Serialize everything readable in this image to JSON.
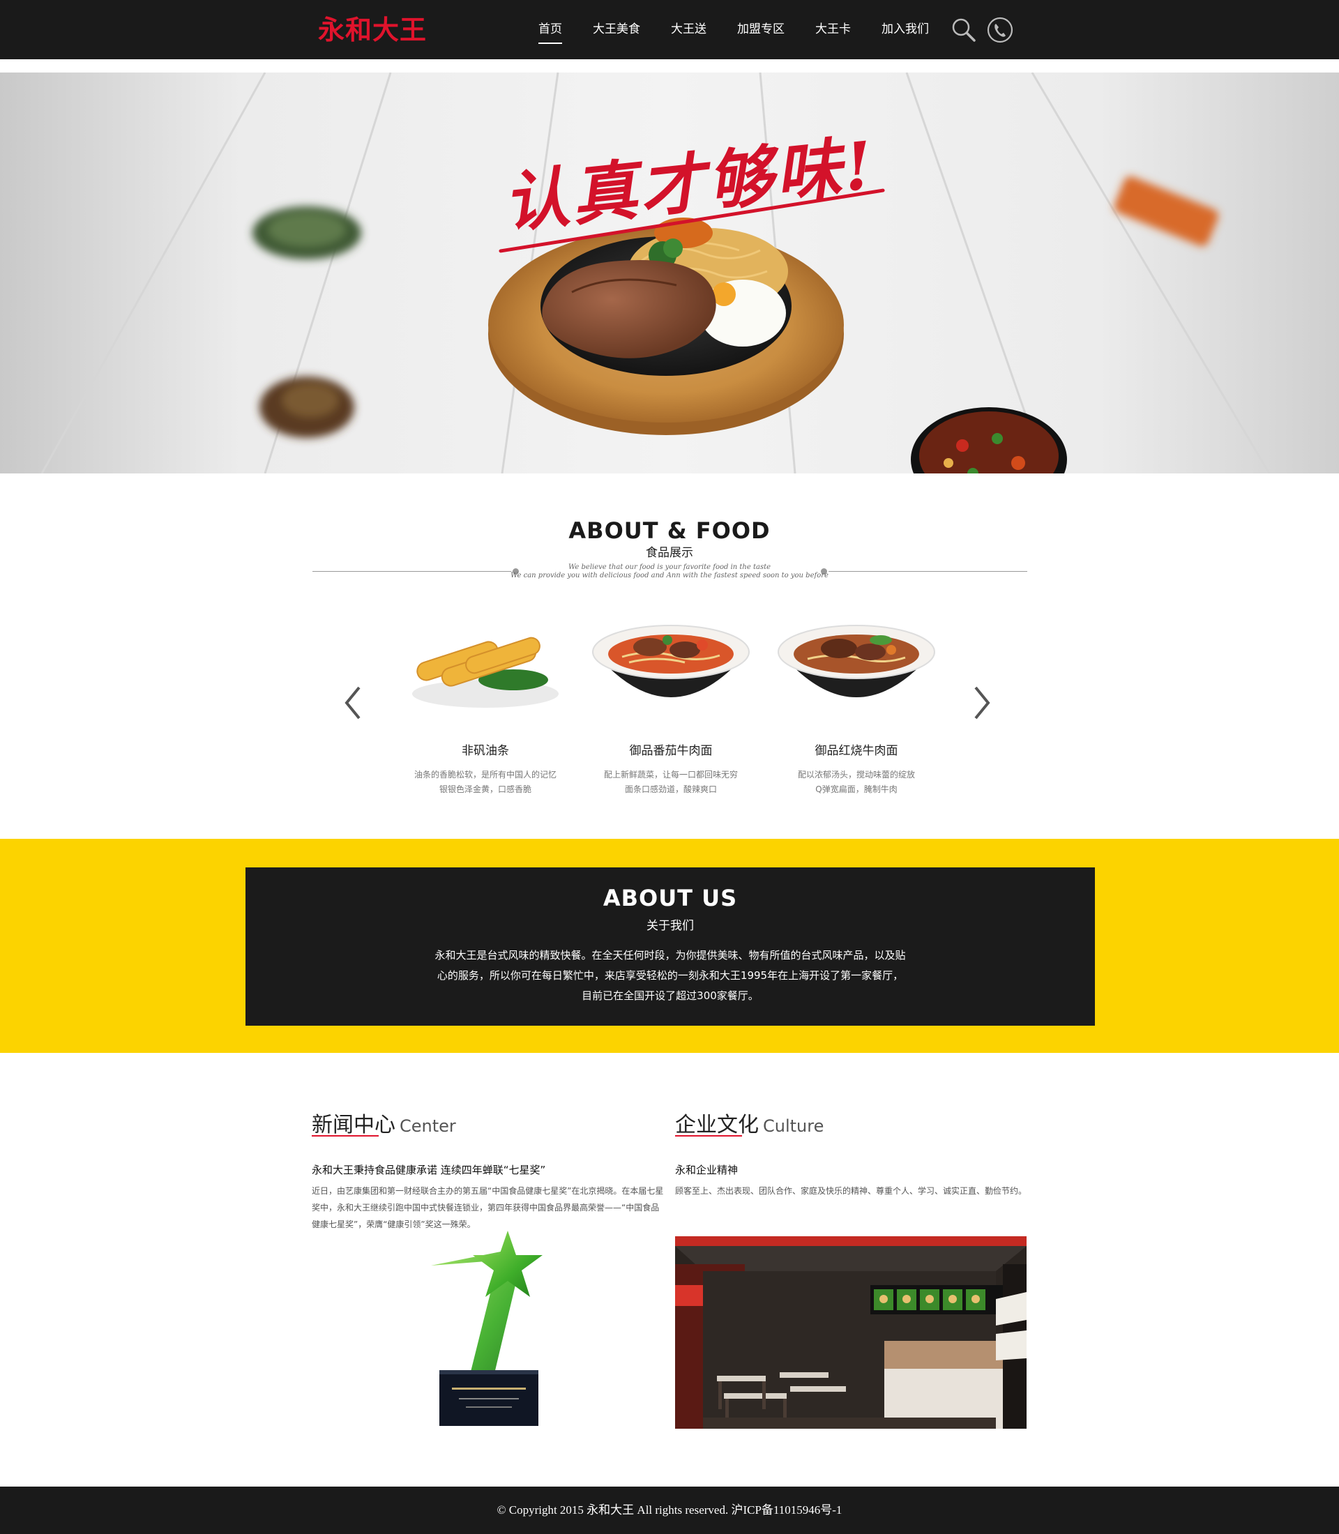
{
  "header": {
    "logo": "永和大王",
    "nav": [
      "首页",
      "大王美食",
      "大王送",
      "加盟专区",
      "大王卡",
      "加入我们"
    ],
    "active_nav": "首页",
    "icons": [
      "search-icon",
      "phone-icon"
    ]
  },
  "hero": {
    "slogan": "认真才够味!"
  },
  "about_food": {
    "title": "ABOUT & FOOD",
    "subtitle": "食品展示",
    "script_line1": "We believe that our food is your favorite food in the taste",
    "script_line2": "We can provide you with delicious food and Ann with the fastest speed soon to you before",
    "items": [
      {
        "name": "非矾油条",
        "desc1": "油条的香脆松软，是所有中国人的记忆",
        "desc2": "银银色泽金黄，口感香脆"
      },
      {
        "name": "御品番茄牛肉面",
        "desc1": "配上新鲜蔬菜，让每一口都回味无穷",
        "desc2": "面条口感劲道，酸辣爽口"
      },
      {
        "name": "御品红烧牛肉面",
        "desc1": "配以浓郁汤头，搅动味蕾的绽放",
        "desc2": "Q弹宽扁面，腌制牛肉"
      }
    ]
  },
  "about_us": {
    "title": "ABOUT  US",
    "subtitle": "关于我们",
    "text": "永和大王是台式风味的精致快餐。在全天任何时段，为你提供美味、物有所值的台式风味产品，以及贴心的服务，所以你可在每日繁忙中，来店享受轻松的一刻永和大王1995年在上海开设了第一家餐厅，目前已在全国开设了超过300家餐厅。"
  },
  "news": {
    "title_cn": "新闻中心",
    "title_en": "Center",
    "headline": "永和大王秉持食品健康承诺 连续四年蝉联“七星奖”",
    "body": "近日，由艺康集团和第一财经联合主办的第五届“中国食品健康七星奖”在北京揭晓。在本届七星奖中，永和大王继续引跑中国中式快餐连锁业，第四年获得中国食品界最高荣誉——“中国食品健康七星奖”，荣膺“健康引领”奖这一殊荣。"
  },
  "culture": {
    "title_cn": "企业文化",
    "title_en": "Culture",
    "headline": "永和企业精神",
    "body": "顾客至上、杰出表现、团队合作、家庭及快乐的精神、尊重个人、学习、诚实正直、勤俭节约。"
  },
  "footer": {
    "copyright": "© Copyright 2015 永和大王 All rights reserved. 沪ICP备11015946号-1"
  },
  "colors": {
    "brand_red": "#e0132c",
    "header_bg": "#1a1a1a",
    "about_band": "#fcd300",
    "about_box": "#1b1b1b"
  }
}
